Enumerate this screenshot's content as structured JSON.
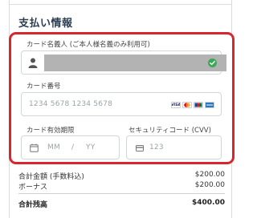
{
  "section_title": "支払い情報",
  "cardholder": {
    "label": "カード名義人 (ご本人様名義のみ利用可)",
    "icons": [
      "person-icon",
      "check-circle-icon"
    ],
    "check_color": "#3aa857"
  },
  "card_number": {
    "label": "カード番号",
    "placeholder": "1234 5678 1234 5678",
    "brands": [
      "VISA",
      "Mastercard",
      "JCB",
      "AMEX"
    ]
  },
  "expiry": {
    "label": "カード有効期限",
    "month_placeholder": "MM",
    "separator": "/",
    "year_placeholder": "YY"
  },
  "cvv": {
    "label": "セキュリティコード (CVV)",
    "placeholder": "123"
  },
  "summary": {
    "rows": [
      {
        "label": "合計金額 (手数料込)",
        "value": "$200.00"
      },
      {
        "label": "ボーナス",
        "value": "$200.00"
      }
    ],
    "total": {
      "label": "合計残高",
      "value": "$400.00"
    }
  },
  "colors": {
    "highlight_border": "#d8262c",
    "title": "#2c3e50"
  }
}
